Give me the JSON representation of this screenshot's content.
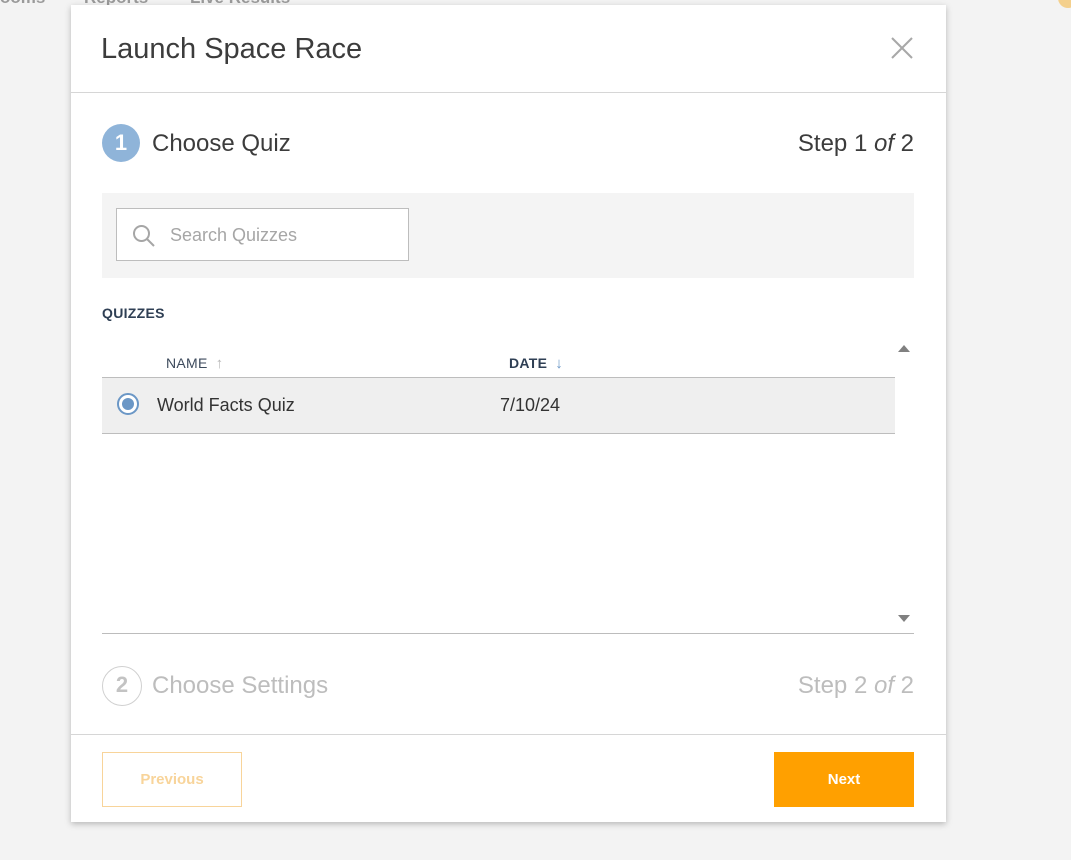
{
  "background": {
    "nav_items": [
      "ooms",
      "Reports",
      "Live Results"
    ]
  },
  "modal": {
    "title": "Launch Space Race",
    "close_icon": "close-icon"
  },
  "step1": {
    "number": "1",
    "title": "Choose Quiz",
    "count_prefix": "Step 1 ",
    "count_of": "of",
    "count_suffix": " 2"
  },
  "search": {
    "placeholder": "Search Quizzes",
    "icon": "search-icon"
  },
  "quizzes": {
    "label": "QUIZZES",
    "columns": {
      "name": "NAME",
      "name_sort": "↑",
      "date": "DATE",
      "date_sort": "↓"
    },
    "rows": [
      {
        "name": "World Facts Quiz",
        "date": "7/10/24",
        "selected": true
      }
    ]
  },
  "step2": {
    "number": "2",
    "title": "Choose Settings",
    "count_prefix": "Step 2 ",
    "count_of": "of",
    "count_suffix": " 2"
  },
  "footer": {
    "previous_label": "Previous",
    "next_label": "Next"
  },
  "colors": {
    "accent_orange": "#ffa000",
    "step_blue": "#8fb4d9",
    "radio_blue": "#6b97c6"
  }
}
